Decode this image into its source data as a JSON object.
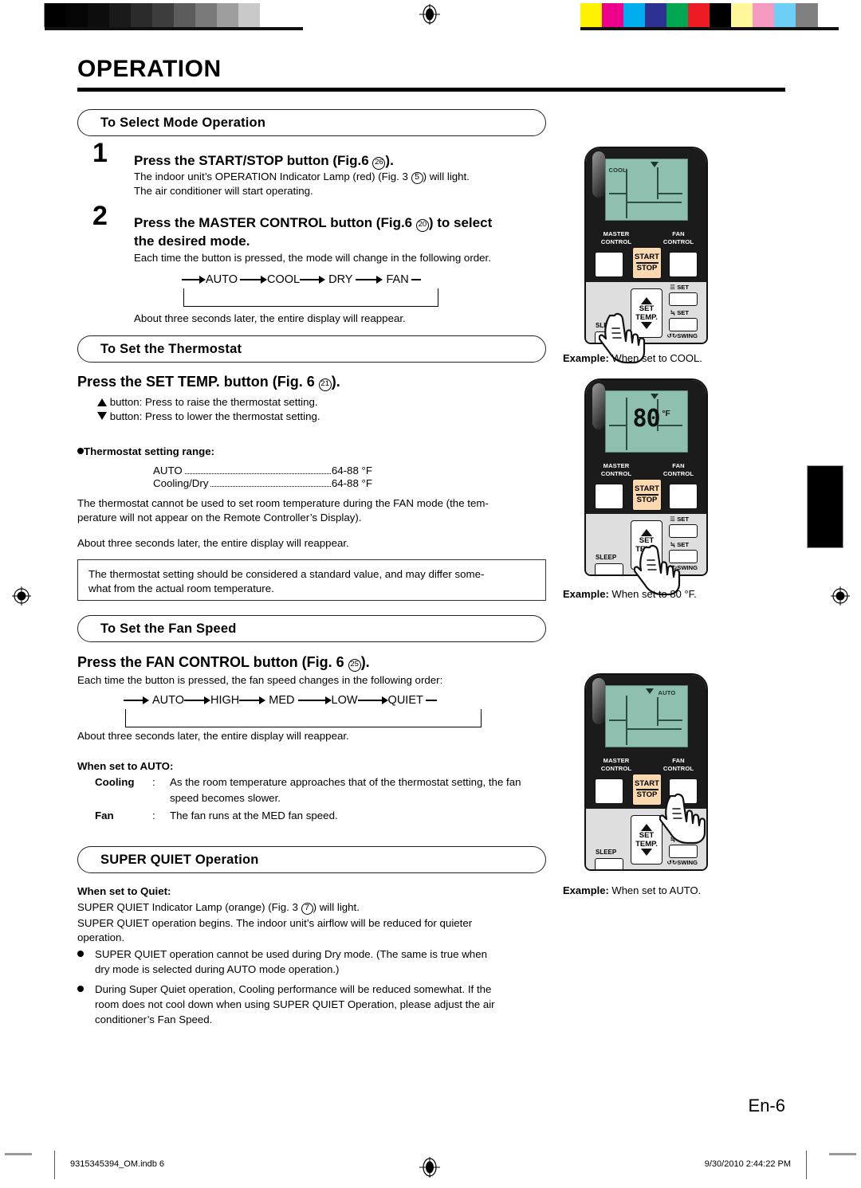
{
  "page": {
    "title": "OPERATION",
    "page_number": "En-6",
    "footer_left": "9315345394_OM.indb   6",
    "footer_right": "9/30/2010   2:44:22 PM"
  },
  "calibration": {
    "gray_swatches": [
      "#000000",
      "#050505",
      "#0d0d0d",
      "#1a1a1a",
      "#2b2b2b",
      "#3d3d3d",
      "#5c5c5c",
      "#7a7a7a",
      "#9e9e9e",
      "#c9c9c9",
      "#ffffff"
    ],
    "color_swatches": [
      "#fff200",
      "#ec008c",
      "#00aeef",
      "#2e3192",
      "#00a651",
      "#ed1c24",
      "#000000",
      "#fff79a",
      "#f49ac1",
      "#6dcff6",
      "#808080"
    ]
  },
  "sections": {
    "mode": {
      "header": "To Select Mode Operation",
      "step1": {
        "number": "1",
        "heading_pre": "Press the START/STOP button (Fig.6 ",
        "heading_circ": "26",
        "heading_post": ").",
        "body_line1": "The indoor unit’s OPERATION Indicator Lamp (red) (Fig. 3 ",
        "body_circ": "5",
        "body_line1_post": ") will light.",
        "body_line2": "The air conditioner will start operating."
      },
      "step2": {
        "number": "2",
        "heading_pre": "Press the MASTER CONTROL button (Fig.6 ",
        "heading_circ": "20",
        "heading_post": ") to select",
        "heading_line2": "the desired mode.",
        "body": "Each time the button is pressed, the mode will change in the following order.",
        "flow": [
          "AUTO",
          "COOL",
          "DRY",
          "FAN"
        ],
        "footnote": "About three seconds later, the entire display will reappear."
      }
    },
    "thermostat": {
      "header": "To Set the Thermostat",
      "heading_pre": "Press the SET TEMP. button (Fig. 6 ",
      "heading_circ": "21",
      "heading_post": ").",
      "arrow_up_text": "button: Press to raise the thermostat setting.",
      "arrow_dn_text": "button: Press to lower the thermostat setting.",
      "range_label": "Thermostat setting range:",
      "ranges": [
        {
          "name": "AUTO",
          "value": "64-88 °F"
        },
        {
          "name": "Cooling/Dry",
          "value": "64-88 °F"
        }
      ],
      "note_line1": "The thermostat cannot be used to set room temperature during the FAN mode (the tem-",
      "note_line2": "perature will not appear on the Remote Controller’s Display).",
      "footnote": "About three seconds later, the entire display will reappear.",
      "box_line1": "The thermostat setting should be considered a standard value, and may differ some-",
      "box_line2": "what from the actual room temperature."
    },
    "fanspeed": {
      "header": "To Set the Fan Speed",
      "heading_pre": "Press the FAN CONTROL button (Fig. 6 ",
      "heading_circ": "25",
      "heading_post": ").",
      "body": "Each time the button is pressed, the fan speed changes in the following order:",
      "flow": [
        "AUTO",
        "HIGH",
        "MED",
        "LOW",
        "QUIET"
      ],
      "footnote": "About three seconds later, the entire display will reappear.",
      "auto_label": "When set to AUTO:",
      "rows": [
        {
          "name": "Cooling",
          "colon": ":",
          "line1": "As the room temperature approaches that of the thermostat setting, the fan",
          "line2": "speed becomes slower."
        },
        {
          "name": "Fan",
          "colon": ":",
          "line1": "The fan runs at the MED fan speed.",
          "line2": ""
        }
      ]
    },
    "superquiet": {
      "header": "SUPER QUIET Operation",
      "quiet_label": "When set to Quiet:",
      "line1_pre": "SUPER QUIET Indicator Lamp (orange) (Fig. 3 ",
      "line1_circ": "7",
      "line1_post": ") will light.",
      "line2": "SUPER QUIET operation begins. The indoor unit’s airflow will be reduced for quieter",
      "line3": "operation.",
      "bullets": [
        [
          "SUPER QUIET operation cannot be used during Dry mode. (The same is true when",
          "dry mode is selected during AUTO mode operation.)"
        ],
        [
          "During Super Quiet operation, Cooling performance will be reduced somewhat. If the",
          "room does not cool down when using SUPER QUIET Operation, please adjust the air",
          "conditioner’s Fan Speed."
        ]
      ]
    }
  },
  "remotes": [
    {
      "id": "cool",
      "lcd_mode": "COOL",
      "lcd_temp": "",
      "lcd_degf": "",
      "lcd_auto": "",
      "labels": {
        "master": [
          "MASTER",
          "CONTROL"
        ],
        "fan": [
          "FAN",
          "CONTROL"
        ],
        "start": "START",
        "stop": "STOP",
        "set_temp": [
          "SET",
          "TEMP."
        ],
        "sleep": "SLEEP",
        "set_vert": "SET",
        "set_horiz": "SET",
        "swing": "SWING"
      },
      "pressed": "master-control",
      "caption_bold": "Example:",
      "caption_text": " When set to COOL."
    },
    {
      "id": "temp80",
      "lcd_mode": "",
      "lcd_temp": "80",
      "lcd_degf": "°F",
      "lcd_auto": "",
      "labels": {
        "master": [
          "MASTER",
          "CONTROL"
        ],
        "fan": [
          "FAN",
          "CONTROL"
        ],
        "start": "START",
        "stop": "STOP",
        "set_temp": [
          "SET",
          "TEMP."
        ],
        "sleep": "SLEEP",
        "set_vert": "SET",
        "set_horiz": "SET",
        "swing": "SWING"
      },
      "pressed": "set-temp",
      "caption_bold": "Example:",
      "caption_text": " When set to 80 °F."
    },
    {
      "id": "auto",
      "lcd_mode": "",
      "lcd_temp": "",
      "lcd_degf": "",
      "lcd_auto": "AUTO",
      "labels": {
        "master": [
          "MASTER",
          "CONTROL"
        ],
        "fan": [
          "FAN",
          "CONTROL"
        ],
        "start": "START",
        "stop": "STOP",
        "set_temp": [
          "SET",
          "TEMP."
        ],
        "sleep": "SLEEP",
        "set_vert": "SET",
        "set_horiz": "SET",
        "swing": "SWING"
      },
      "pressed": "fan-control",
      "caption_bold": "Example:",
      "caption_text": " When set to AUTO."
    }
  ],
  "colors": {
    "lcd": "#8fbfae",
    "start_stop": "#fbd9b0",
    "remote_body": "#dedede",
    "remote_dark": "#1b1b1b"
  }
}
